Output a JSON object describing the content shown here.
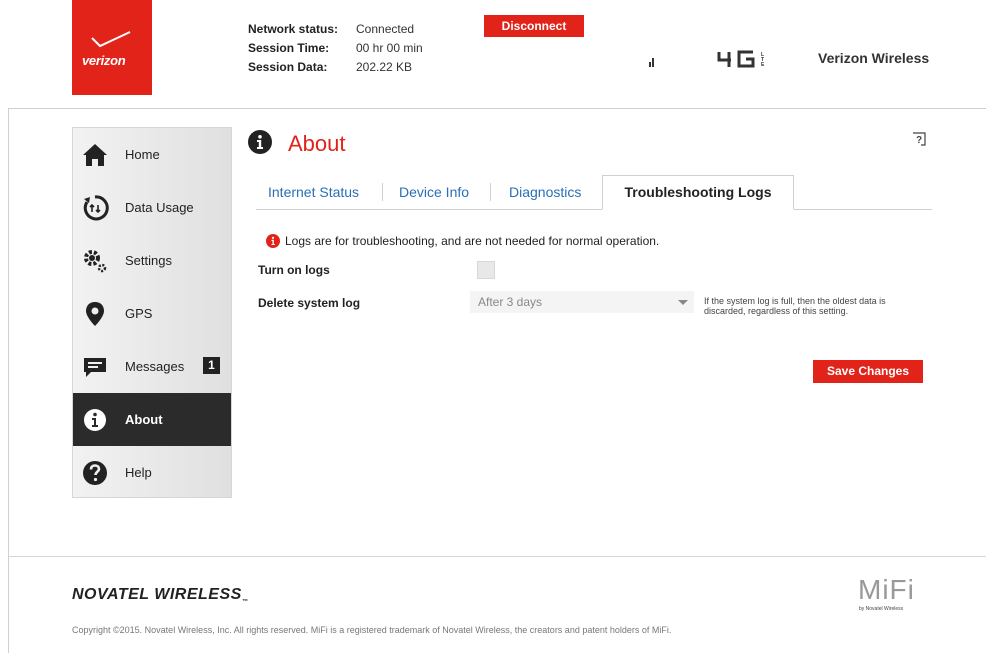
{
  "header": {
    "logo_text": "verizon",
    "network_status_label": "Network status:",
    "network_status_value": "Connected",
    "session_time_label": "Session Time:",
    "session_time_value": "00 hr 00 min",
    "session_data_label": "Session Data:",
    "session_data_value": "202.22 KB",
    "disconnect_label": "Disconnect",
    "network_type": "4G LTE",
    "carrier": "Verizon Wireless"
  },
  "sidebar": {
    "items": [
      {
        "label": "Home",
        "icon": "home-icon"
      },
      {
        "label": "Data Usage",
        "icon": "data-usage-icon"
      },
      {
        "label": "Settings",
        "icon": "gears-icon"
      },
      {
        "label": "GPS",
        "icon": "location-pin-icon"
      },
      {
        "label": "Messages",
        "icon": "message-icon",
        "badge": "1"
      },
      {
        "label": "About",
        "icon": "info-icon",
        "active": true
      },
      {
        "label": "Help",
        "icon": "question-icon"
      }
    ]
  },
  "main": {
    "title": "About",
    "help_icon": "help-icon",
    "tabs": [
      {
        "label": "Internet Status"
      },
      {
        "label": "Device Info"
      },
      {
        "label": "Diagnostics"
      },
      {
        "label": "Troubleshooting Logs",
        "active": true
      }
    ],
    "info_text": "Logs are for troubleshooting, and are not needed for normal operation.",
    "turn_on_logs_label": "Turn on logs",
    "turn_on_logs_checked": false,
    "delete_log_label": "Delete system log",
    "delete_log_value": "After 3 days",
    "delete_log_hint": "If the system log is full, then the oldest data is discarded, regardless of this setting.",
    "save_label": "Save Changes"
  },
  "footer": {
    "brand": "NOVATEL WIRELESS",
    "brand_tm": "™",
    "mifi": "MiFi",
    "mifi_sub": "by Novatel Wireless",
    "copyright": "Copyright ©2015. Novatel Wireless, Inc. All rights reserved. MiFi is a registered trademark of Novatel Wireless, the creators and patent holders of MiFi."
  },
  "colors": {
    "accent": "#e2231a",
    "link": "#2a6fb6",
    "active_nav": "#2b2b2b"
  }
}
